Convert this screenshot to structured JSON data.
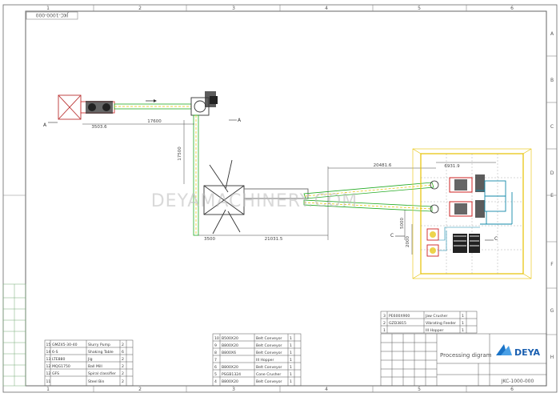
{
  "frame": {
    "col_labels": [
      "1",
      "2",
      "3",
      "4",
      "5",
      "6"
    ],
    "row_labels": [
      "A",
      "B",
      "C",
      "D",
      "E",
      "F",
      "G",
      "H"
    ],
    "drawing_ref_top": "JKC-1000-000"
  },
  "watermark": "DEYAMACHINERY.COM",
  "dimensions": {
    "d1": "3503.6",
    "d2": "17600",
    "d3": "17500",
    "d4": "3500",
    "d5": "21031.5",
    "d6": "20481.6",
    "d7": "6931.9",
    "d8": "5000",
    "d9": "2000"
  },
  "section_marks": {
    "a_left": "A",
    "a_right": "A",
    "c_left": "C",
    "c_right": "C"
  },
  "bom_left": [
    {
      "no": "15",
      "spec": "GMZ45-30-40",
      "name": "Slurry Pump",
      "qty": "2"
    },
    {
      "no": "14",
      "spec": "6-S",
      "name": "Shaking Table",
      "qty": "6"
    },
    {
      "no": "13",
      "spec": "LTE880",
      "name": "Jig",
      "qty": "2"
    },
    {
      "no": "12",
      "spec": "MQG1750",
      "name": "Ball Mill",
      "qty": "2"
    },
    {
      "no": "12",
      "spec": "GFS",
      "name": "Spiral classifier",
      "qty": "2"
    },
    {
      "no": "11",
      "spec": "",
      "name": "Steel Bin",
      "qty": "2"
    }
  ],
  "bom_mid": [
    {
      "no": "10",
      "spec": "B500X20",
      "name": "Belt Conveyor",
      "qty": "1"
    },
    {
      "no": "9",
      "spec": "B800X20",
      "name": "Belt Conveyor",
      "qty": "1"
    },
    {
      "no": "8",
      "spec": "B800X6",
      "name": "Belt Conveyor",
      "qty": "1"
    },
    {
      "no": "7",
      "spec": "",
      "name": "III Hopper",
      "qty": "1"
    },
    {
      "no": "6",
      "spec": "B800X20",
      "name": "Belt Conveyor",
      "qty": "1"
    },
    {
      "no": "5",
      "spec": "PSGB1324",
      "name": "Cone Crusher",
      "qty": "1"
    },
    {
      "no": "4",
      "spec": "B800X20",
      "name": "Belt Conveyor",
      "qty": "1"
    }
  ],
  "bom_right": [
    {
      "no": "3",
      "spec": "PE600X900",
      "name": "Jaw Crusher",
      "qty": "1"
    },
    {
      "no": "2",
      "spec": "GZD3815",
      "name": "Vibrating Feeder",
      "qty": "1"
    },
    {
      "no": "1",
      "spec": "",
      "name": "III Hopper",
      "qty": "1"
    }
  ],
  "title_block": {
    "title": "Processing digram",
    "company": "DEYA",
    "drawing_no": "JKC-1000-000"
  }
}
